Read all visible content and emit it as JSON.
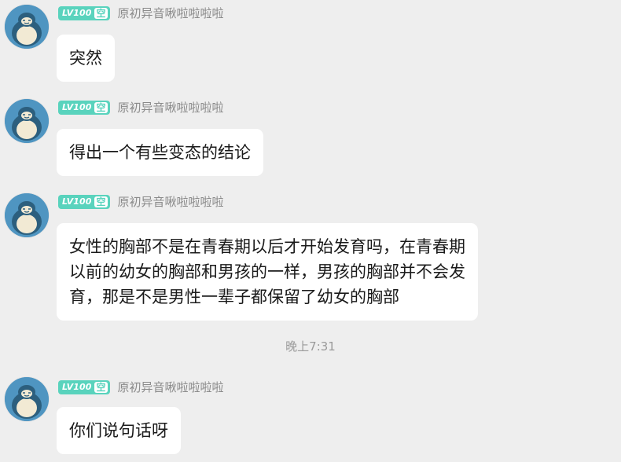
{
  "messages": [
    {
      "level_badge": "LV100",
      "level_suffix": "空",
      "nickname": "原初异音啾啦啦啦啦",
      "lines": [
        "突然"
      ]
    },
    {
      "level_badge": "LV100",
      "level_suffix": "空",
      "nickname": "原初异音啾啦啦啦啦",
      "lines": [
        "得出一个有些变态的结论"
      ]
    },
    {
      "level_badge": "LV100",
      "level_suffix": "空",
      "nickname": "原初异音啾啦啦啦啦",
      "lines": [
        "女性的胸部不是在青春期以后才开始发育吗，在青春期",
        "以前的幼女的胸部和男孩的一样，男孩的胸部并不会发",
        "育，那是不是男性一辈子都保留了幼女的胸部"
      ]
    },
    {
      "level_badge": "LV100",
      "level_suffix": "空",
      "nickname": "原初异音啾啦啦啦啦",
      "lines": [
        "你们说句话呀"
      ]
    }
  ],
  "timestamp": "晚上7:31",
  "colors": {
    "background": "#eeeeee",
    "bubble": "#ffffff",
    "badge": "#59d3bd",
    "nickname": "#8a8a8a",
    "avatar": "#4f95c1"
  },
  "icons": {
    "avatar": "snorlax-avatar-icon"
  }
}
